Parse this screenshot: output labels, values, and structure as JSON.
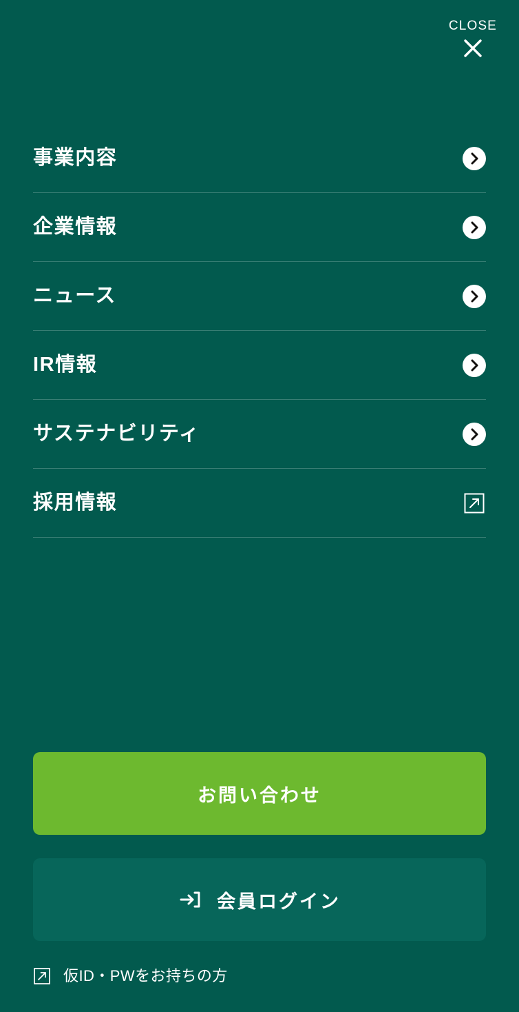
{
  "theme": {
    "background": "#025A4E",
    "accent_green": "#6DB92F",
    "login_button_bg": "#07665A",
    "text": "#ffffff",
    "divider": "rgba(255,255,255,0.22)"
  },
  "header": {
    "close_label": "CLOSE",
    "close_icon": "close-x-icon"
  },
  "menu": {
    "items": [
      {
        "label": "事業内容",
        "icon": "chevron-right-circle-icon",
        "type": "internal"
      },
      {
        "label": "企業情報",
        "icon": "chevron-right-circle-icon",
        "type": "internal"
      },
      {
        "label": "ニュース",
        "icon": "chevron-right-circle-icon",
        "type": "internal"
      },
      {
        "label": "IR情報",
        "icon": "chevron-right-circle-icon",
        "type": "internal"
      },
      {
        "label": "サステナビリティ",
        "icon": "chevron-right-circle-icon",
        "type": "internal"
      },
      {
        "label": "採用情報",
        "icon": "external-link-icon",
        "type": "external"
      }
    ]
  },
  "actions": {
    "contact_label": "お問い合わせ",
    "login_label": "会員ログイン",
    "login_icon": "sign-in-icon",
    "temp_credentials_label": "仮ID・PWをお持ちの方",
    "temp_credentials_icon": "external-link-icon"
  }
}
